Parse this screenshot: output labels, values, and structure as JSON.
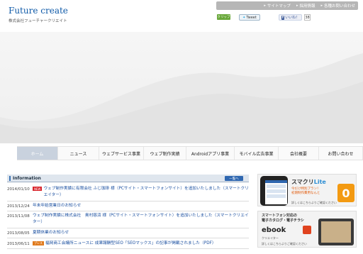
{
  "header": {
    "logo": "Future create",
    "company": "株式会社フューチャークリエイト",
    "util_links": [
      {
        "label": "サイトマップ"
      },
      {
        "label": "採用情報"
      },
      {
        "label": "各種お問い合わせ"
      }
    ],
    "social": {
      "clip": "クリップ",
      "tweet": "Tweet",
      "like": "いいね！",
      "like_count": "38"
    }
  },
  "nav": {
    "items": [
      {
        "label": "ホーム"
      },
      {
        "label": "ニュース"
      },
      {
        "label": "ウェブサービス事業"
      },
      {
        "label": "ウェブ制作実績"
      },
      {
        "label": "Androidアプリ事業"
      },
      {
        "label": "モバイル広告事業"
      },
      {
        "label": "会社概要"
      },
      {
        "label": "お問い合わせ"
      }
    ]
  },
  "info": {
    "title": "Information",
    "list_button": "一覧へ",
    "news": [
      {
        "date": "2014/01/10",
        "badge": "NEW",
        "text": "ウェブ制作実績に有限会社 ふじ珈琲 様（PCサイト・スマートフォンサイト）を追加いたしました（スマートクリエイター）"
      },
      {
        "date": "2013/12/24",
        "badge": "",
        "text": "年末年始営業日のお知らせ"
      },
      {
        "date": "2013/11/08",
        "badge": "",
        "text": "ウェブ制作実績に株式会社　奥村慈済 様（PCサイト・スマートフォンサイト）を追加いたしました（スマートクリエイター）"
      },
      {
        "date": "2013/08/05",
        "badge": "",
        "text": "夏期休業のお知らせ"
      },
      {
        "date": "2013/06/11",
        "badge": "プレス",
        "text": "福岡商工会議所ニュースに 成果報酬型SEO「SEOマックス」の記事が掲載されました（PDF）"
      }
    ]
  },
  "banners": {
    "b1": {
      "title_main": "スマクリ",
      "title_accent": "Lite",
      "line1": "今だけ特別プラン！",
      "line2": "初期制作費用なんと",
      "zero": "0",
      "link": "詳しくはこちらよりご確認ください"
    },
    "b2": {
      "line1": "スマートフォン対応の",
      "line2": "電子カタログ・電子チラシ",
      "logo": "ebook",
      "sub": "クリエイター",
      "link": "詳しくはこちらよりご確認ください"
    }
  },
  "colors": {
    "brand": "#0f5aa8",
    "link": "#1a4fa0",
    "new_badge": "#d8232a",
    "press_badge": "#e07a1c",
    "accent_orange": "#f39a12"
  }
}
